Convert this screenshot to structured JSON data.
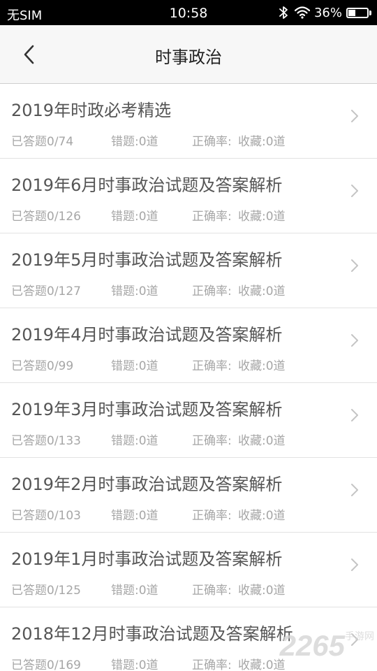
{
  "status_bar": {
    "carrier": "无SIM",
    "time": "10:58",
    "battery_percent": "36%",
    "battery_level": 0.36,
    "icons": [
      "bluetooth-icon",
      "wifi-icon",
      "battery-icon"
    ]
  },
  "header": {
    "title": "时事政治",
    "back_icon": "chevron-left-icon"
  },
  "list": {
    "items": [
      {
        "title": "2019年时政必考精选",
        "answered": "已答题0/74",
        "wrong": "错题:0道",
        "accuracy": "正确率:",
        "favorites": "收藏:0道"
      },
      {
        "title": "2019年6月时事政治试题及答案解析",
        "answered": "已答题0/126",
        "wrong": "错题:0道",
        "accuracy": "正确率:",
        "favorites": "收藏:0道"
      },
      {
        "title": "2019年5月时事政治试题及答案解析",
        "answered": "已答题0/127",
        "wrong": "错题:0道",
        "accuracy": "正确率:",
        "favorites": "收藏:0道"
      },
      {
        "title": "2019年4月时事政治试题及答案解析",
        "answered": "已答题0/99",
        "wrong": "错题:0道",
        "accuracy": "正确率:",
        "favorites": "收藏:0道"
      },
      {
        "title": "2019年3月时事政治试题及答案解析",
        "answered": "已答题0/133",
        "wrong": "错题:0道",
        "accuracy": "正确率:",
        "favorites": "收藏:0道"
      },
      {
        "title": "2019年2月时事政治试题及答案解析",
        "answered": "已答题0/103",
        "wrong": "错题:0道",
        "accuracy": "正确率:",
        "favorites": "收藏:0道"
      },
      {
        "title": "2019年1月时事政治试题及答案解析",
        "answered": "已答题0/125",
        "wrong": "错题:0道",
        "accuracy": "正确率:",
        "favorites": "收藏:0道"
      },
      {
        "title": "2018年12月时事政治试题及答案解析",
        "answered": "已答题0/169",
        "wrong": "错题:0道",
        "accuracy": "正确率:",
        "favorites": "收藏:0道"
      }
    ]
  },
  "watermark": {
    "main": "2265",
    "sub": "手游网"
  },
  "colors": {
    "status_bar_bg": "#000000",
    "header_bg": "#f7f7f7",
    "title_text": "#555555",
    "stat_text": "#a6a6a6",
    "divider": "#e2e2e2"
  }
}
